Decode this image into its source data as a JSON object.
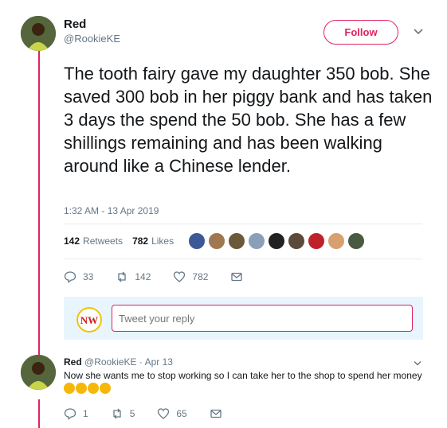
{
  "tweet": {
    "author_name": "Red",
    "author_handle": "@RookieKE",
    "follow_label": "Follow",
    "text": "The tooth fairy gave my daughter 350 bob. She saved 300 bob in her piggy bank and has taken 3 days the spend the 50 bob. She has a few shillings remaining and has been walking around like a Chinese lender.",
    "timestamp": "1:32 AM - 13 Apr 2019",
    "retweets_count": "142",
    "retweets_label": "Retweets",
    "likes_count": "782",
    "likes_label": "Likes",
    "actions": {
      "reply_count": "33",
      "retweet_count": "142",
      "like_count": "782"
    }
  },
  "reply_box": {
    "placeholder": "Tweet your reply",
    "avatar_text": "NW"
  },
  "reply": {
    "author_name": "Red",
    "author_handle": "@RookieKE",
    "date": "· Apr 13",
    "text": "Now she wants me to stop working so I can take her to the shop to spend her money",
    "emoji_count": 4,
    "actions": {
      "reply_count": "1",
      "retweet_count": "5",
      "like_count": "65"
    }
  },
  "colors": {
    "accent": "#e0245e",
    "secondary_text": "#657786",
    "reply_box_bg": "#e8f5fd"
  },
  "icons": [
    "chevron-down-icon",
    "reply-icon",
    "retweet-icon",
    "heart-icon",
    "message-icon"
  ]
}
